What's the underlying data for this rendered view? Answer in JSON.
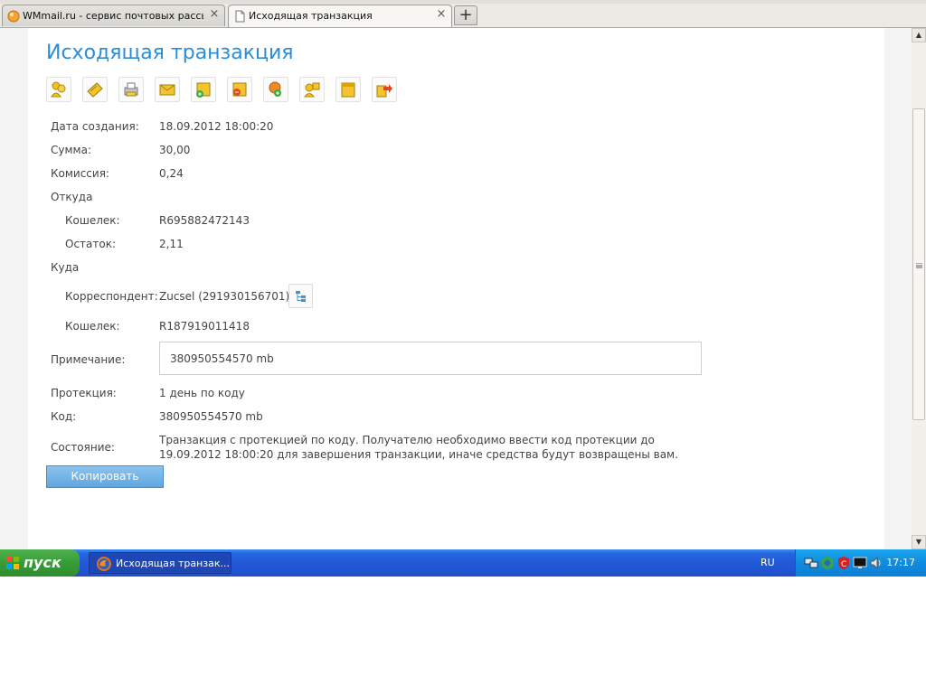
{
  "browser": {
    "tabs": [
      {
        "title": "WMmail.ru - сервис почтовых рассылок...",
        "active": false
      },
      {
        "title": "Исходящая транзакция",
        "active": true
      }
    ],
    "new_tab_label": "+",
    "close_glyph": "×"
  },
  "page": {
    "title": "Исходящая транзакция",
    "toolbar_icons": [
      "users-icon",
      "wallet-icon",
      "printer-icon",
      "messages-icon",
      "invoice-add-icon",
      "invoice-remove-icon",
      "payment-add-icon",
      "contacts-icon",
      "archive-icon",
      "transfer-icon"
    ],
    "fields": {
      "created_label": "Дата создания:",
      "created_value": "18.09.2012 18:00:20",
      "amount_label": "Сумма:",
      "amount_value": "30,00",
      "fee_label": "Комиссия:",
      "fee_value": "0,24",
      "from_label": "Откуда",
      "from_wallet_label": "Кошелек:",
      "from_wallet_value": "R695882472143",
      "balance_label": "Остаток:",
      "balance_value": "2,11",
      "to_label": "Куда",
      "correspondent_label": "Корреспондент:",
      "correspondent_value": "Zucsel (291930156701)",
      "to_wallet_label": "Кошелек:",
      "to_wallet_value": "R187919011418",
      "note_label": "Примечание:",
      "note_value": "380950554570 mb",
      "protection_label": "Протекция:",
      "protection_value": "1 день по коду",
      "code_label": "Код:",
      "code_value": "380950554570 mb",
      "state_label": "Состояние:",
      "state_value": "Транзакция с протекцией по коду. Получателю необходимо ввести код протекции до 19.09.2012 18:00:20 для завершения транзакции, иначе средства будут возвращены вам."
    },
    "copy_button": "Копировать"
  },
  "taskbar": {
    "start_label": "пуск",
    "task_label": "Исходящая транзак...",
    "language": "RU",
    "clock": "17:17"
  }
}
